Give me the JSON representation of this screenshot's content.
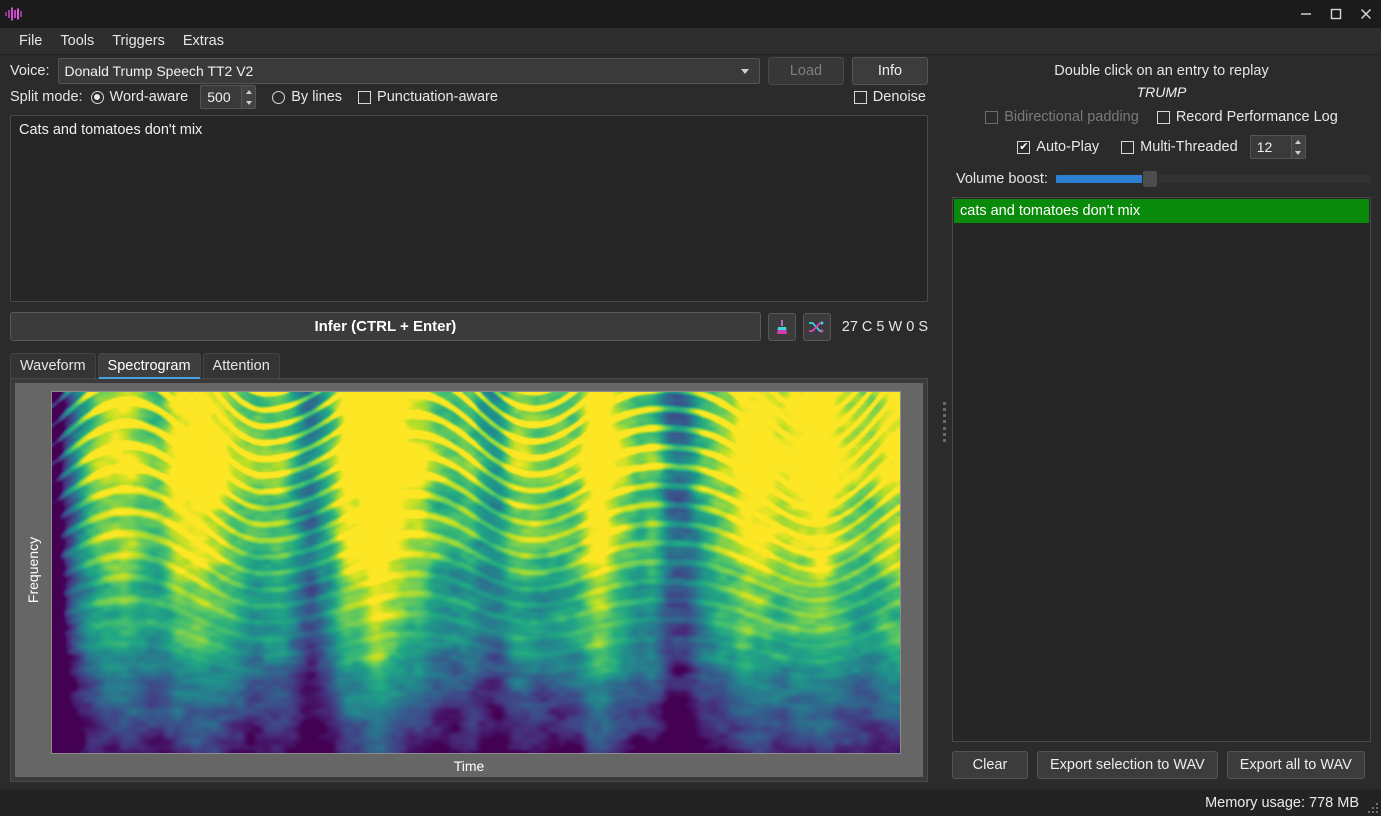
{
  "window": {
    "logo_icon": "audio-waveform-icon",
    "minimize_label": "minimize-icon",
    "maximize_label": "maximize-icon",
    "close_label": "close-icon"
  },
  "menubar": {
    "items": [
      {
        "label": "File"
      },
      {
        "label": "Tools"
      },
      {
        "label": "Triggers"
      },
      {
        "label": "Extras"
      }
    ]
  },
  "voice_row": {
    "label": "Voice:",
    "selected": "Donald Trump Speech TT2 V2",
    "load_label": "Load",
    "info_label": "Info"
  },
  "split_row": {
    "label": "Split mode:",
    "word_aware_label": "Word-aware",
    "word_aware_checked": true,
    "chunk_size": "500",
    "by_lines_label": "By lines",
    "by_lines_checked": false,
    "punctuation_label": "Punctuation-aware",
    "punctuation_checked": false,
    "denoise_label": "Denoise",
    "denoise_checked": false
  },
  "editor": {
    "text": "Cats and tomatoes don't mix"
  },
  "infer": {
    "button_label": "Infer (CTRL + Enter)",
    "clean_icon": "broom-icon",
    "shuffle_icon": "shuffle-icon",
    "stats": "27 C 5 W 0 S"
  },
  "tabs": {
    "items": [
      {
        "label": "Waveform",
        "active": false
      },
      {
        "label": "Spectrogram",
        "active": true
      },
      {
        "label": "Attention",
        "active": false
      }
    ]
  },
  "plot": {
    "ylabel": "Frequency",
    "xlabel": "Time",
    "panel_bg": "#666666"
  },
  "right_panel": {
    "hint": "Double click on an entry to replay",
    "voice_tag": "TRUMP",
    "bidirectional_padding_label": "Bidirectional padding",
    "bidirectional_padding_checked": false,
    "bidirectional_padding_disabled": true,
    "record_log_label": "Record Performance Log",
    "record_log_checked": false,
    "autoplay_label": "Auto-Play",
    "autoplay_checked": true,
    "multithreaded_label": "Multi-Threaded",
    "multithreaded_checked": false,
    "thread_count": "12",
    "volume_label": "Volume boost:",
    "volume_percent": 30,
    "entries": [
      {
        "text": "cats and tomatoes don't mix",
        "selected": true,
        "color": "#0a8a0a"
      }
    ],
    "clear_label": "Clear",
    "export_selection_label": "Export selection to WAV",
    "export_all_label": "Export all to WAV"
  },
  "statusbar": {
    "memory": "Memory usage: 778 MB"
  }
}
